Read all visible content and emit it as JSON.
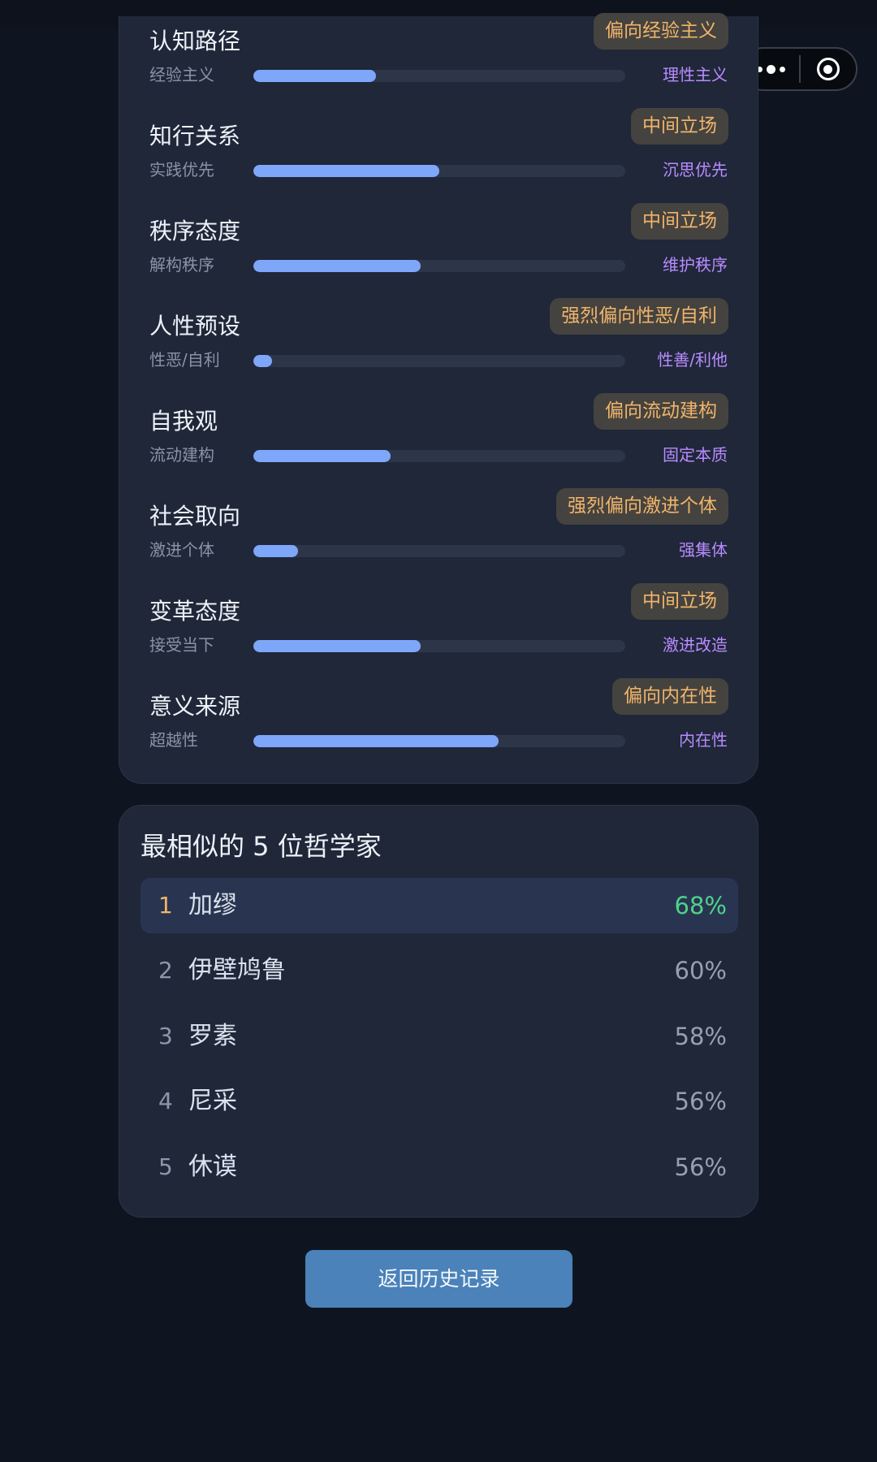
{
  "capsule": {
    "more_icon": "more-dots-icon",
    "close_icon": "target-icon"
  },
  "dimensions": [
    {
      "title": "认知路径",
      "badge": "偏向经验主义",
      "left": "经验主义",
      "right": "理性主义",
      "fill_pct": 33
    },
    {
      "title": "知行关系",
      "badge": "中间立场",
      "left": "实践优先",
      "right": "沉思优先",
      "fill_pct": 50
    },
    {
      "title": "秩序态度",
      "badge": "中间立场",
      "left": "解构秩序",
      "right": "维护秩序",
      "fill_pct": 45
    },
    {
      "title": "人性预设",
      "badge": "强烈偏向性恶/自利",
      "left": "性恶/自利",
      "right": "性善/利他",
      "fill_pct": 5
    },
    {
      "title": "自我观",
      "badge": "偏向流动建构",
      "left": "流动建构",
      "right": "固定本质",
      "fill_pct": 37
    },
    {
      "title": "社会取向",
      "badge": "强烈偏向激进个体",
      "left": "激进个体",
      "right": "强集体",
      "fill_pct": 12
    },
    {
      "title": "变革态度",
      "badge": "中间立场",
      "left": "接受当下",
      "right": "激进改造",
      "fill_pct": 45
    },
    {
      "title": "意义来源",
      "badge": "偏向内在性",
      "left": "超越性",
      "right": "内在性",
      "fill_pct": 66
    }
  ],
  "philosophers": {
    "title": "最相似的 5 位哲学家",
    "items": [
      {
        "rank": "1",
        "name": "加缪",
        "pct": "68%"
      },
      {
        "rank": "2",
        "name": "伊壁鸠鲁",
        "pct": "60%"
      },
      {
        "rank": "3",
        "name": "罗素",
        "pct": "58%"
      },
      {
        "rank": "4",
        "name": "尼采",
        "pct": "56%"
      },
      {
        "rank": "5",
        "name": "休谟",
        "pct": "56%"
      }
    ]
  },
  "back_button": {
    "label": "返回历史记录"
  },
  "colors": {
    "background": "#0f1520",
    "card": "#1f2739",
    "badge_text": "#f0b46b",
    "bar_fill": "#7ea6f9",
    "right_label": "#b98bff",
    "top_percent": "#4fd18b",
    "button": "#4a82b9"
  }
}
